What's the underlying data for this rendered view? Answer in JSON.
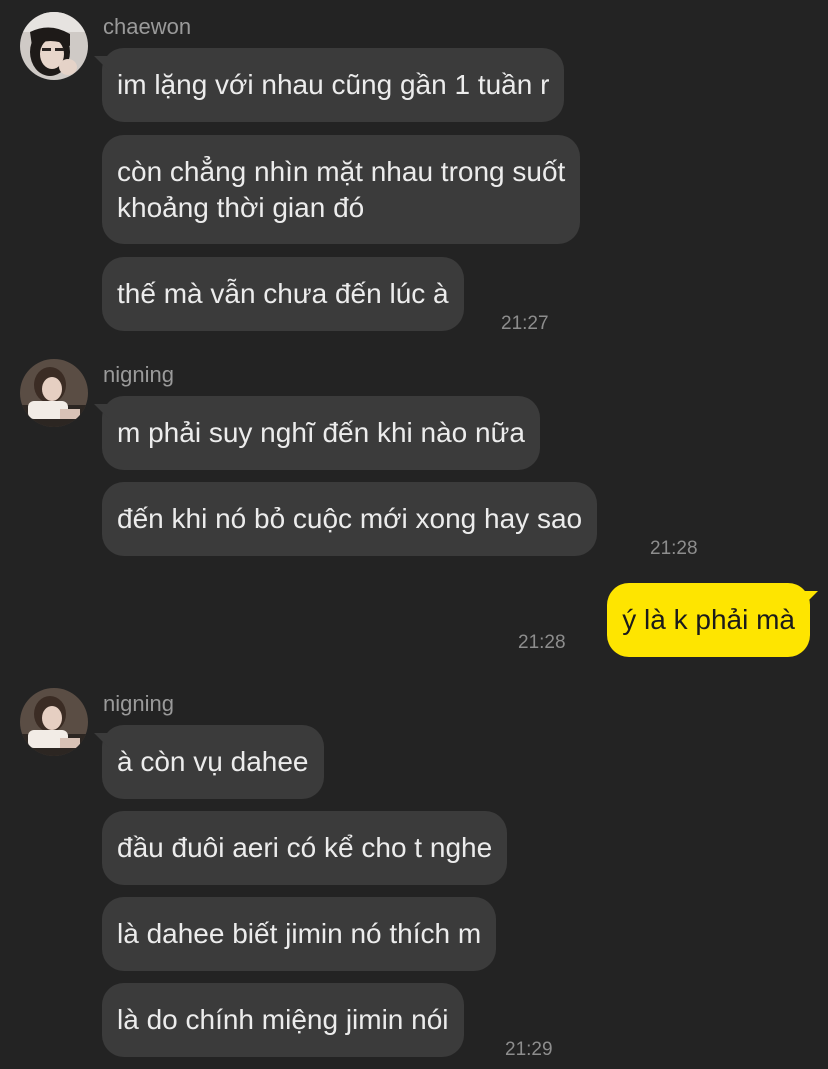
{
  "senders": {
    "chaewon": "chaewon",
    "nigning_1": "nigning",
    "nigning_2": "nigning"
  },
  "messages": {
    "m1": "im lặng với nhau cũng gần 1 tuần r",
    "m2_line1": "còn chẳng nhìn mặt nhau trong suốt",
    "m2_line2": "khoảng thời gian đó",
    "m3": "thế mà vẫn chưa đến lúc à",
    "m4": "m phải suy nghĩ đến khi nào nữa",
    "m5": "đến khi nó bỏ cuộc mới xong hay sao",
    "m6": "ý là k phải mà",
    "m7": "à còn vụ dahee",
    "m8": "đầu đuôi aeri có kể cho t nghe",
    "m9": "là dahee biết jimin nó thích m",
    "m10": "là do chính miệng jimin nói"
  },
  "times": {
    "t1": "21:27",
    "t2": "21:28",
    "t3": "21:28",
    "t4": "21:29"
  },
  "colors": {
    "background": "#232323",
    "incoming_bubble": "#3b3b3b",
    "outgoing_bubble": "#fee500"
  }
}
